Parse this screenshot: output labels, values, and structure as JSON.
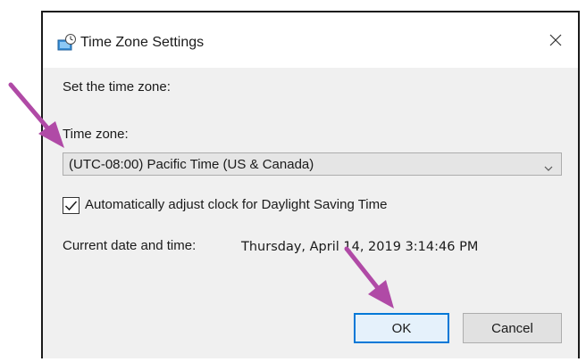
{
  "window": {
    "title": "Time Zone Settings",
    "icon": "clock-globe-icon",
    "close_icon": "close-icon"
  },
  "prompt": {
    "label": "Set the time zone:"
  },
  "timezone": {
    "label": "Time zone:",
    "selected": "(UTC-08:00) Pacific Time (US & Canada)",
    "chevron_icon": "chevron-down-icon"
  },
  "dst": {
    "checked": true,
    "label": "Automatically adjust clock for Daylight Saving Time"
  },
  "current": {
    "label": "Current date and time:",
    "value": "Thursday, April 14, 2019 3:14:46 PM"
  },
  "buttons": {
    "ok": "OK",
    "cancel": "Cancel"
  },
  "colors": {
    "annotation_arrow": "#b04aa6",
    "dialog_background": "#f0f0f0",
    "titlebar_background": "#ffffff",
    "ok_focus_border": "#0078d7"
  }
}
